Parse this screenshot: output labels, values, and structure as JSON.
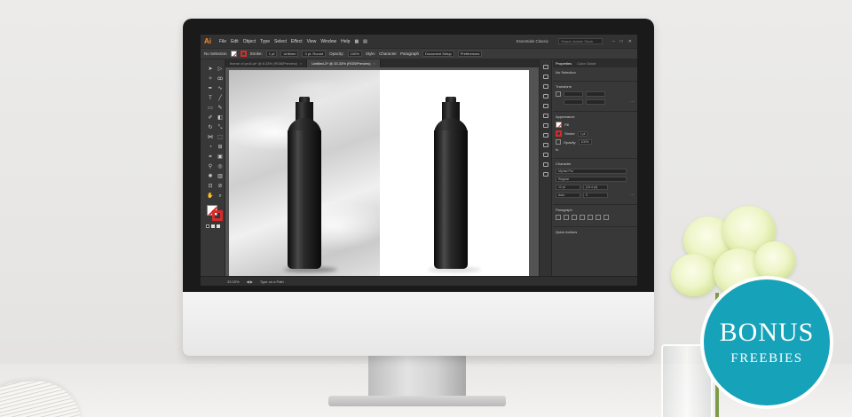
{
  "app": {
    "logo": "Ai",
    "menu": [
      "File",
      "Edit",
      "Object",
      "Type",
      "Select",
      "Effect",
      "View",
      "Window",
      "Help"
    ],
    "workspace": "Essentials Classic",
    "search_placeholder": "Search Adobe Stock"
  },
  "control_bar": {
    "selection": "No Selection",
    "stroke_label": "Stroke:",
    "stroke_value": "1 pt",
    "stroke_profile": "Uniform",
    "brush": "3 pt. Round",
    "opacity_label": "Opacity:",
    "opacity_value": "100%",
    "style_label": "Style:",
    "character": "Character",
    "paragraph": "Paragraph",
    "doc_setup": "Document Setup",
    "preferences": "Preferences"
  },
  "documents": {
    "tabs": [
      {
        "label": "theme of pro5.ai* @ 8.33% (RGB/Preview)",
        "active": false
      },
      {
        "label": "Untitled-3* @ 33.33% (RGB/Preview)",
        "active": true
      }
    ]
  },
  "status_bar": {
    "zoom": "33.33%",
    "tool": "Type on a Path"
  },
  "properties_panel": {
    "tabs": [
      "Properties",
      "Color Guide"
    ],
    "selection": "No Selection",
    "transform": "Transform",
    "appearance": "Appearance",
    "fill": "Fill",
    "stroke": "Stroke",
    "stroke_value": "1 pt",
    "opacity": "Opacity",
    "opacity_value": "100%",
    "fx": "fx.",
    "character": "Character",
    "font": "Myriad Pro",
    "font_style": "Regular",
    "font_size": "12 pt",
    "leading": "(14.4 pt)",
    "kerning": "Auto",
    "tracking": "0",
    "paragraph": "Paragraph",
    "quick_actions": "Quick Actions"
  },
  "badge": {
    "line1": "BONUS",
    "line2": "FREEBIES"
  },
  "colors": {
    "badge": "#16a2b9",
    "ai_orange": "#ff8a1f",
    "stroke_red": "#d52b2b"
  }
}
